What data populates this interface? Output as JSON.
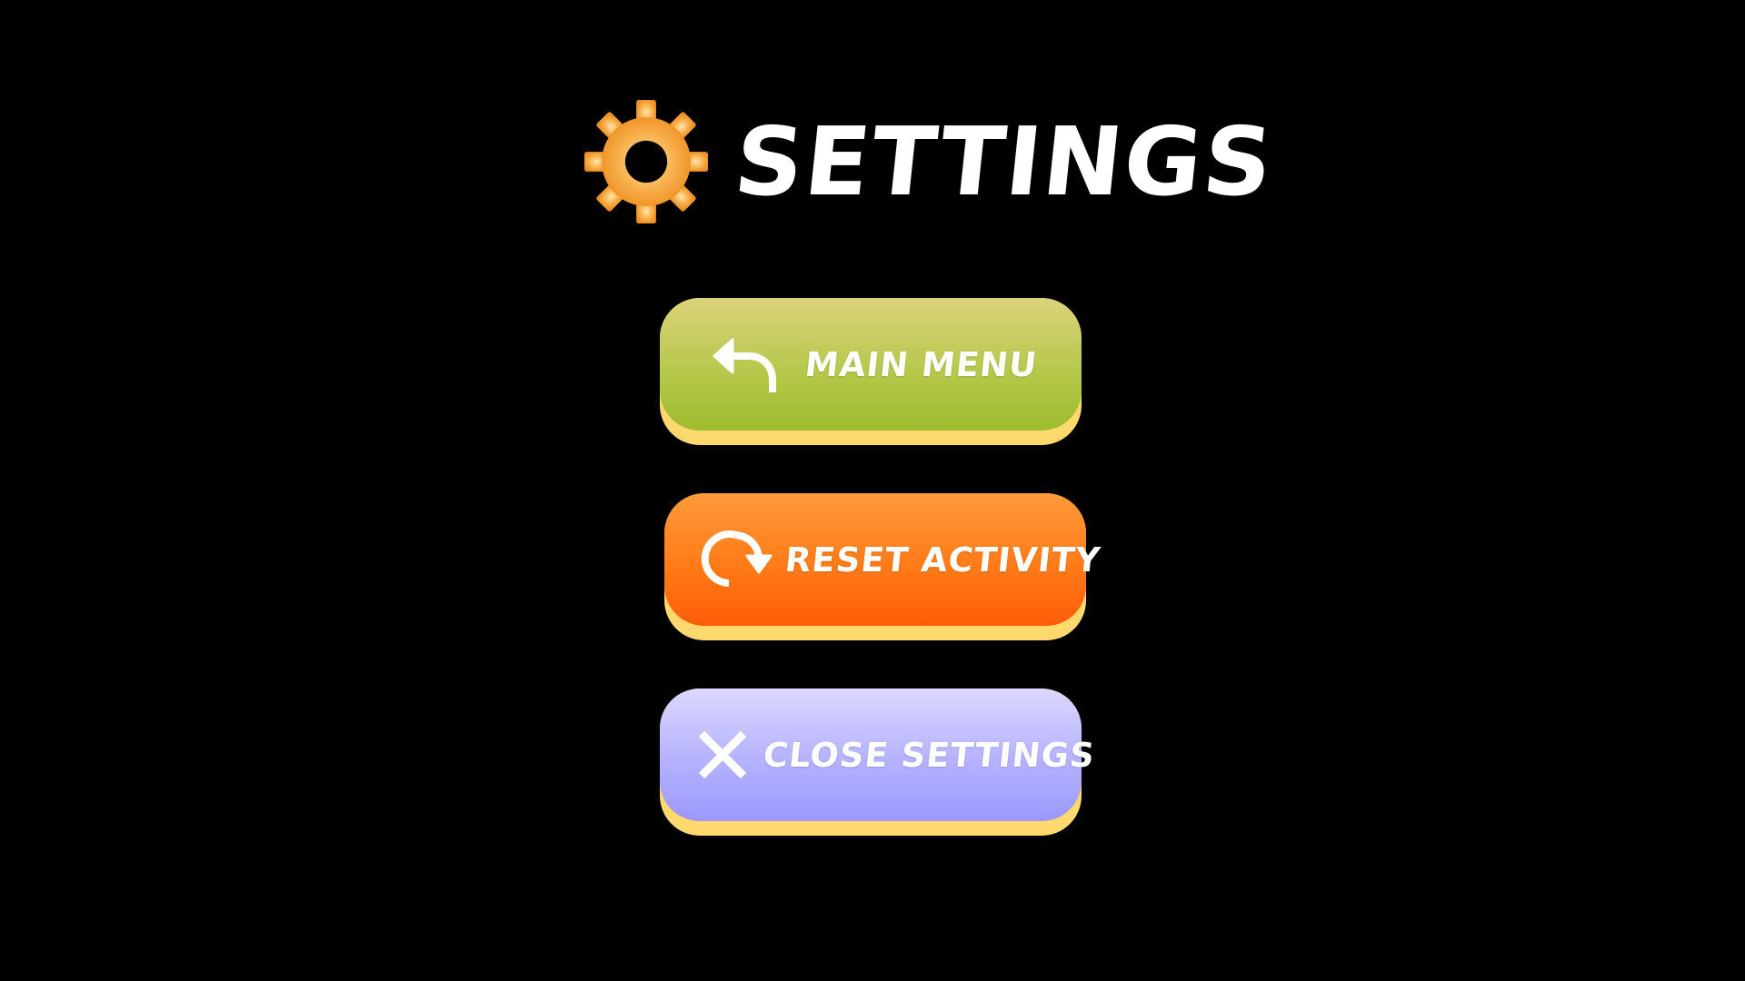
{
  "header": {
    "title": "SETTINGS",
    "icon": "gear-icon"
  },
  "buttons": {
    "main_menu": {
      "label": "MAIN MENU",
      "icon": "undo-arrow-icon"
    },
    "reset_activity": {
      "label": "RESET ACTIVITY",
      "icon": "reload-icon"
    },
    "close_settings": {
      "label": "CLOSE SETTINGS",
      "icon": "close-icon"
    }
  },
  "colors": {
    "background": "#000000",
    "gear": "#f5a53a",
    "main_menu": "#a8c23a",
    "reset_activity": "#ff6f12",
    "close_settings": "#a9a6ff",
    "button_base": "#ffd86e",
    "text": "#ffffff"
  }
}
